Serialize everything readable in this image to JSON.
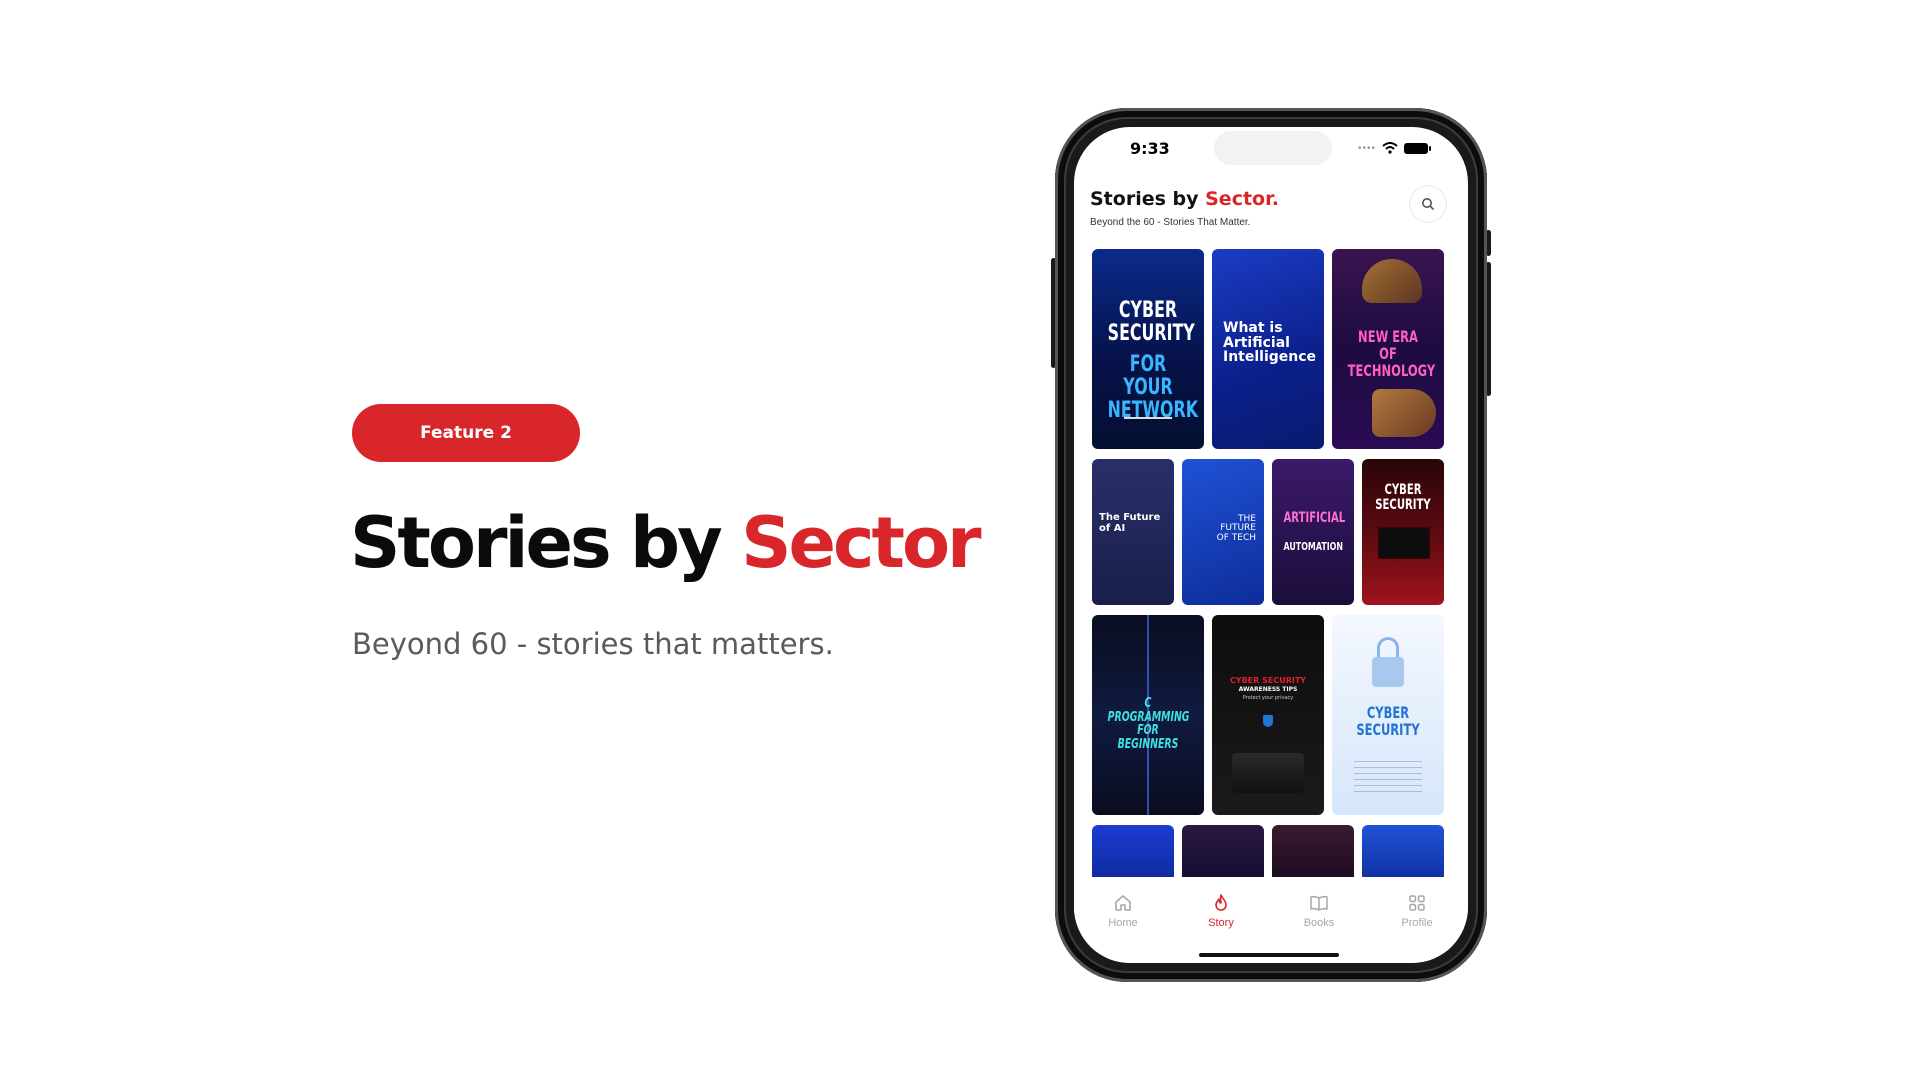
{
  "feature": {
    "badge_label": "Feature 2"
  },
  "headline": {
    "part1": "Stories by",
    "part2": "Sector"
  },
  "tagline": "Beyond 60 - stories that matters.",
  "phone": {
    "status": {
      "time": "9:33"
    },
    "header": {
      "title_part1": "Stories by",
      "title_part2": "Sector.",
      "subtitle": "Beyond the 60 - Stories That Matter."
    },
    "stories": [
      {
        "title": "CYBER\nSECURITY",
        "title2": "FOR YOUR\nNETWORK"
      },
      {
        "title": "What is\nArtificial\nIntelligence"
      },
      {
        "title": "NEW ERA OF\nTECHNOLOGY"
      },
      {
        "title": "The Future\nof AI"
      },
      {
        "title": "THE\nFUTURE\nOF TECH"
      },
      {
        "title": "ARTIFICIAL",
        "title2": "AUTOMATION"
      },
      {
        "title": "CYBER\nSECURITY"
      },
      {
        "title": "C PROGRAMMING\nFOR BEGINNERS"
      },
      {
        "title": "CYBER SECURITY",
        "title2": "AWARENESS TIPS",
        "title3": "Protect your privacy"
      },
      {
        "title": "CYBER\nSECURITY"
      }
    ],
    "nav": [
      {
        "label": "Home",
        "icon": "home-icon"
      },
      {
        "label": "Story",
        "icon": "flame-icon",
        "active": true
      },
      {
        "label": "Books",
        "icon": "book-icon"
      },
      {
        "label": "Profile",
        "icon": "grid-icon"
      }
    ]
  },
  "colors": {
    "accent": "#d9262a",
    "text_dark": "#0b0b0b",
    "text_muted": "#5a5a5a",
    "nav_inactive": "#a7a7a7"
  }
}
